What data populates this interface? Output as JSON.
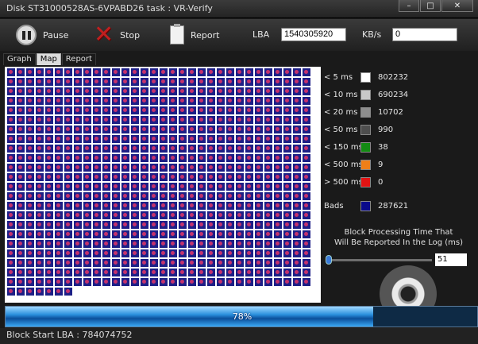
{
  "window": {
    "title": "Disk ST31000528AS-6VPABD26   task : VR-Verify",
    "minimize_glyph": "–",
    "maximize_glyph": "□",
    "close_glyph": "✕"
  },
  "toolbar": {
    "pause_label": "Pause",
    "stop_label": "Stop",
    "report_label": "Report",
    "lba_label": "LBA",
    "lba_value": "1540305920",
    "kbs_label": "KB/s",
    "kbs_value": "0",
    "icons": {
      "pause": "pause-icon",
      "stop": "stop-x-icon",
      "report": "clipboard-icon"
    }
  },
  "tabs": [
    {
      "label": "Graph",
      "active": false
    },
    {
      "label": "Map",
      "active": true
    },
    {
      "label": "Report",
      "active": false
    }
  ],
  "legend": [
    {
      "label": "< 5 ms",
      "color": "#ffffff",
      "count": "802232"
    },
    {
      "label": "< 10 ms",
      "color": "#c8c8c8",
      "count": "690234"
    },
    {
      "label": "< 20 ms",
      "color": "#8e8e8e",
      "count": "10702"
    },
    {
      "label": "< 50 ms",
      "color": "#4e4e4e",
      "count": "990"
    },
    {
      "label": "< 150 ms",
      "color": "#138a13",
      "count": "38"
    },
    {
      "label": "< 500 ms",
      "color": "#f07f18",
      "count": "9"
    },
    {
      "label": "> 500 ms",
      "color": "#e21313",
      "count": "0"
    },
    {
      "label": "Bads",
      "color": "#0a0a8a",
      "count": "287621"
    }
  ],
  "block_time": {
    "line1": "Block Processing Time That",
    "line2": "Will Be Reported In the Log (ms)",
    "value": "51"
  },
  "map": {
    "block_color": "#1d1f86",
    "bad_mark_color": "#c4326d"
  },
  "progress": {
    "percent": 78,
    "label": "78%"
  },
  "status": {
    "text": "Block Start LBA : 784074752"
  }
}
